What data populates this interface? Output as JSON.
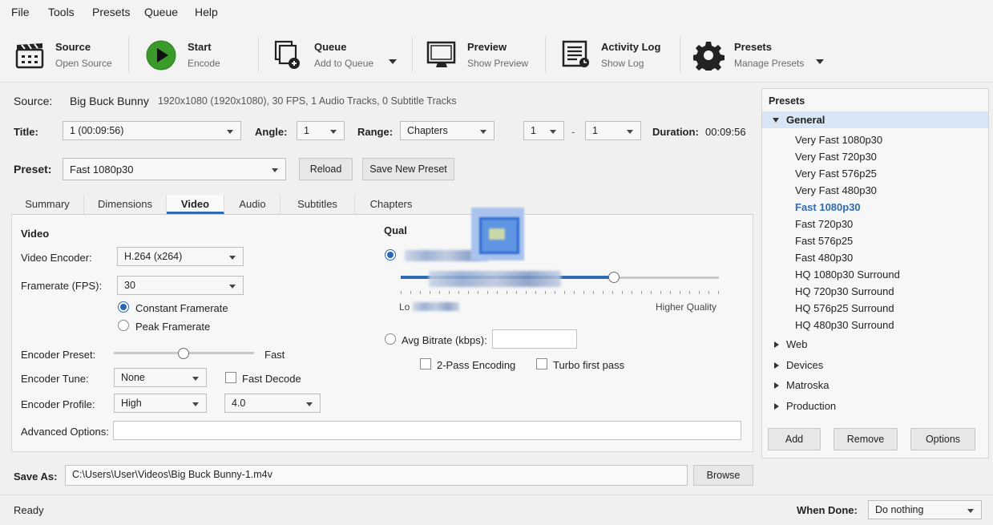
{
  "menu": [
    "File",
    "Tools",
    "Presets",
    "Queue",
    "Help"
  ],
  "toolbar": {
    "source": {
      "title": "Source",
      "sub": "Open Source",
      "icon": "clapperboard-icon"
    },
    "start": {
      "title": "Start",
      "sub": "Encode",
      "icon": "play-icon"
    },
    "queue": {
      "title": "Queue",
      "sub": "Add to Queue",
      "icon": "queue-icon"
    },
    "preview": {
      "title": "Preview",
      "sub": "Show Preview",
      "icon": "monitor-icon"
    },
    "log": {
      "title": "Activity Log",
      "sub": "Show Log",
      "icon": "log-icon"
    },
    "presets": {
      "title": "Presets",
      "sub": "Manage Presets",
      "icon": "gear-icon"
    }
  },
  "source": {
    "label": "Source:",
    "name": "Big Buck Bunny",
    "info": "1920x1080 (1920x1080), 30 FPS, 1 Audio Tracks, 0 Subtitle Tracks"
  },
  "title_row": {
    "title_label": "Title:",
    "title_value": "1 (00:09:56)",
    "angle_label": "Angle:",
    "angle_value": "1",
    "range_label": "Range:",
    "range_value": "Chapters",
    "range_from": "1",
    "range_dash": "-",
    "range_to": "1",
    "duration_label": "Duration:",
    "duration_value": "00:09:56"
  },
  "preset_row": {
    "label": "Preset:",
    "value": "Fast 1080p30",
    "reload": "Reload",
    "save_new": "Save New Preset"
  },
  "tabs": [
    "Summary",
    "Dimensions",
    "Video",
    "Audio",
    "Subtitles",
    "Chapters"
  ],
  "video": {
    "heading": "Video",
    "encoder_label": "Video Encoder:",
    "encoder_value": "H.264 (x264)",
    "framerate_label": "Framerate (FPS):",
    "framerate_value": "30",
    "constant_label": "Constant Framerate",
    "peak_label": "Peak Framerate",
    "preset_label": "Encoder Preset:",
    "preset_value": "Fast",
    "tune_label": "Encoder Tune:",
    "tune_value": "None",
    "fast_decode_label": "Fast Decode",
    "profile_label": "Encoder Profile:",
    "profile_value": "High",
    "level_value": "4.0",
    "advanced_label": "Advanced Options:",
    "advanced_value": ""
  },
  "quality": {
    "heading": "Qual",
    "higher_label": "Higher Quality",
    "lower_label": "Lo",
    "slider_level": 0.67,
    "bitrate_label": "Avg Bitrate (kbps):",
    "bitrate_value": "",
    "twopass_label": "2-Pass Encoding",
    "turbo_label": "Turbo first pass"
  },
  "save": {
    "label": "Save As:",
    "path": "C:\\Users\\User\\Videos\\Big Buck Bunny-1.m4v",
    "browse": "Browse"
  },
  "presets_panel": {
    "heading": "Presets",
    "general_label": "General",
    "general_items": [
      "Very Fast 1080p30",
      "Very Fast 720p30",
      "Very Fast 576p25",
      "Very Fast 480p30",
      "Fast 1080p30",
      "Fast 720p30",
      "Fast 576p25",
      "Fast 480p30",
      "HQ 1080p30 Surround",
      "HQ 720p30 Surround",
      "HQ 576p25 Surround",
      "HQ 480p30 Surround"
    ],
    "selected": "Fast 1080p30",
    "groups": [
      "Web",
      "Devices",
      "Matroska",
      "Production"
    ],
    "add": "Add",
    "remove": "Remove",
    "options": "Options"
  },
  "status": {
    "text": "Ready",
    "when_done_label": "When Done:",
    "when_done_value": "Do nothing"
  },
  "colors": {
    "accent": "#2f6ab2",
    "play": "#3a9a2a",
    "selected_bg": "#d8e6f6"
  }
}
